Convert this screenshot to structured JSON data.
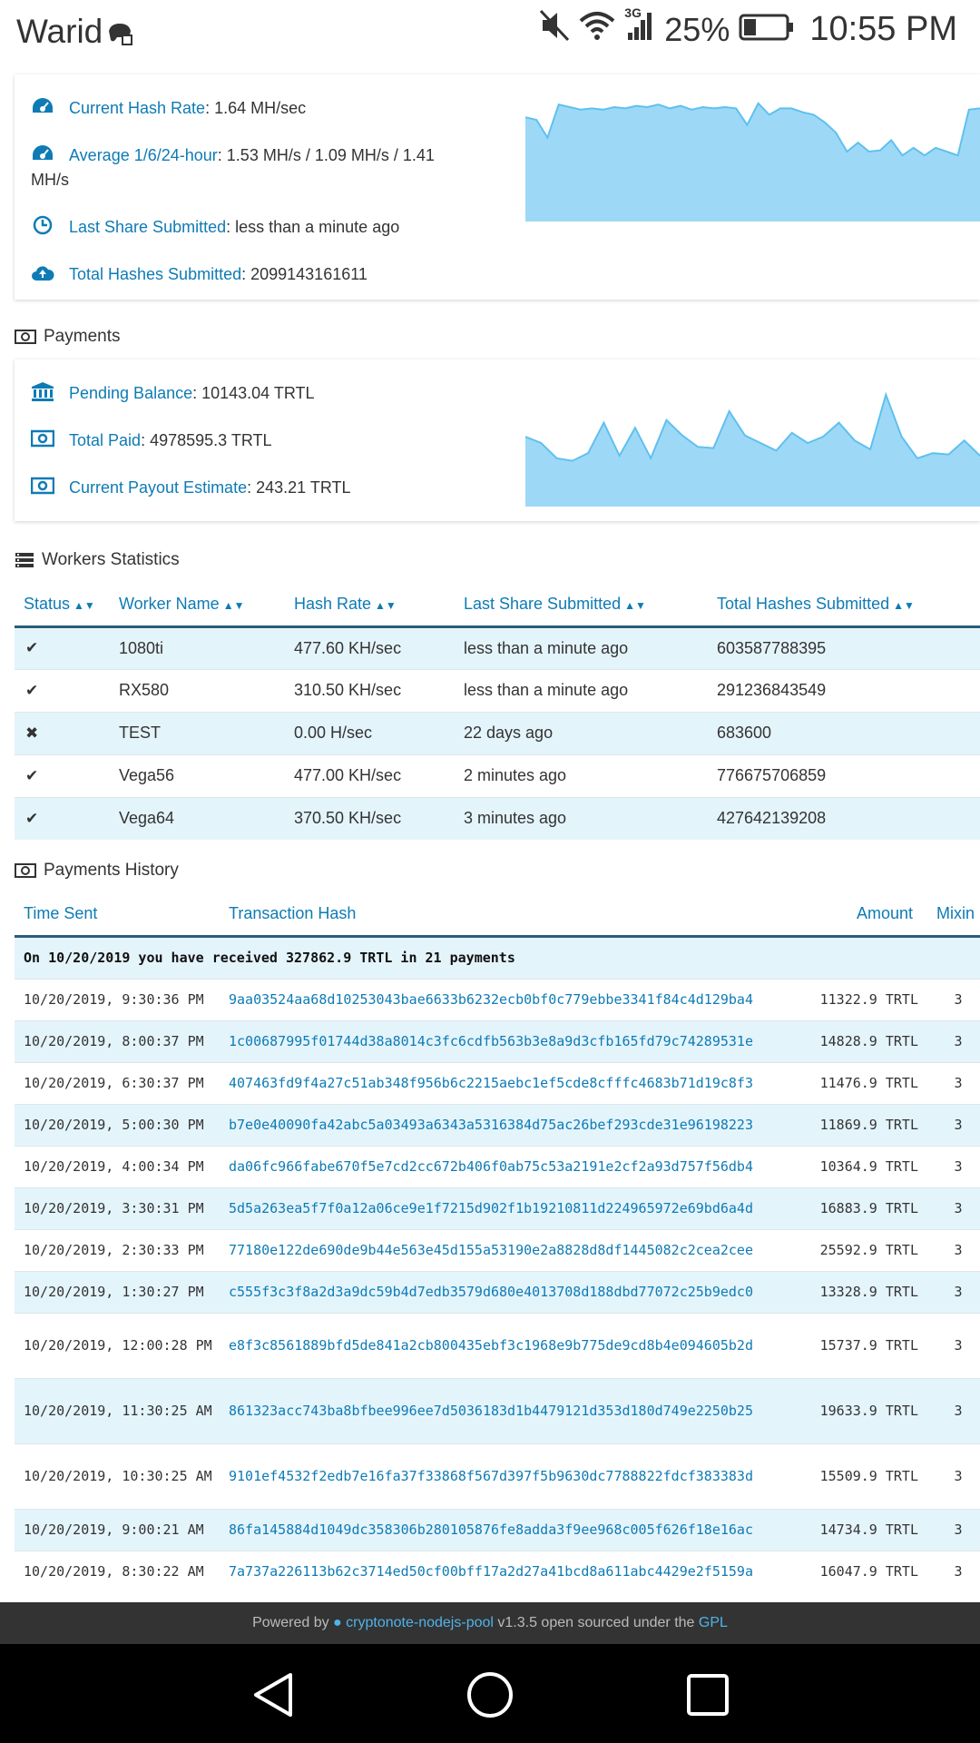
{
  "statusbar": {
    "carrier": "Warid",
    "battery": "25%",
    "time": "10:55 PM",
    "network": "3G"
  },
  "stats": {
    "hash_rate_label": "Current Hash Rate",
    "hash_rate_value": ": 1.64 MH/sec",
    "average_label": "Average 1/6/24-hour",
    "average_value": ": 1.53 MH/s / 1.09 MH/s / 1.41",
    "average_value_cont": "MH/s",
    "last_share_label": "Last Share Submitted",
    "last_share_value": ": less than a minute ago",
    "total_hashes_label": "Total Hashes Submitted",
    "total_hashes_value": ": 2099143161611"
  },
  "payments_section": {
    "title": "Payments",
    "pending_label": "Pending Balance",
    "pending_value": ": 10143.04 TRTL",
    "total_paid_label": "Total Paid",
    "total_paid_value": ": 4978595.3 TRTL",
    "estimate_label": "Current Payout Estimate",
    "estimate_value": ": 243.21 TRTL"
  },
  "chart_data": [
    {
      "type": "area",
      "y": [
        0.82,
        0.8,
        0.66,
        0.92,
        0.9,
        0.88,
        0.89,
        0.88,
        0.9,
        0.89,
        0.91,
        0.9,
        0.92,
        0.89,
        0.91,
        0.88,
        0.9,
        0.89,
        0.9,
        0.89,
        0.76,
        0.93,
        0.84,
        0.89,
        0.89,
        0.86,
        0.84,
        0.78,
        0.7,
        0.55,
        0.62,
        0.55,
        0.56,
        0.64,
        0.52,
        0.58,
        0.52,
        0.58,
        0.55,
        0.52,
        0.88,
        0.89
      ],
      "color": "#9dd9f6"
    },
    {
      "type": "area",
      "y": [
        0.55,
        0.5,
        0.38,
        0.36,
        0.42,
        0.66,
        0.4,
        0.62,
        0.38,
        0.68,
        0.56,
        0.47,
        0.46,
        0.75,
        0.56,
        0.5,
        0.44,
        0.58,
        0.5,
        0.55,
        0.66,
        0.52,
        0.45,
        0.88,
        0.55,
        0.38,
        0.42,
        0.41,
        0.52,
        0.4
      ],
      "color": "#9dd9f6"
    }
  ],
  "workers": {
    "title": "Workers Statistics",
    "headers": [
      "Status",
      "Worker Name",
      "Hash Rate",
      "Last Share Submitted",
      "Total Hashes Submitted"
    ],
    "rows": [
      {
        "status": "✔",
        "name": "1080ti",
        "rate": "477.60 KH/sec",
        "last": "less than a minute ago",
        "total": "603587788395"
      },
      {
        "status": "✔",
        "name": "RX580",
        "rate": "310.50 KH/sec",
        "last": "less than a minute ago",
        "total": "291236843549"
      },
      {
        "status": "✖",
        "name": "TEST",
        "rate": "0.00 H/sec",
        "last": "22 days ago",
        "total": "683600"
      },
      {
        "status": "✔",
        "name": "Vega56",
        "rate": "477.00 KH/sec",
        "last": "2 minutes ago",
        "total": "776675706859"
      },
      {
        "status": "✔",
        "name": "Vega64",
        "rate": "370.50 KH/sec",
        "last": "3 minutes ago",
        "total": "427642139208"
      }
    ]
  },
  "payments_history": {
    "title": "Payments History",
    "headers": [
      "Time Sent",
      "Transaction Hash",
      "Amount",
      "Mixin"
    ],
    "summary": "On 10/20/2019 you have received 327862.9 TRTL in 21 payments",
    "rows": [
      {
        "time": "10/20/2019, 9:30:36 PM",
        "hash": "9aa03524aa68d10253043bae6633b6232ecb0bf0c779ebbe3341f84c4d129ba4",
        "amount": "11322.9 TRTL",
        "mixin": "3"
      },
      {
        "time": "10/20/2019, 8:00:37 PM",
        "hash": "1c00687995f01744d38a8014c3fc6cdfb563b3e8a9d3cfb165fd79c74289531e",
        "amount": "14828.9 TRTL",
        "mixin": "3"
      },
      {
        "time": "10/20/2019, 6:30:37 PM",
        "hash": "407463fd9f4a27c51ab348f956b6c2215aebc1ef5cde8cfffc4683b71d19c8f3",
        "amount": "11476.9 TRTL",
        "mixin": "3"
      },
      {
        "time": "10/20/2019, 5:00:30 PM",
        "hash": "b7e0e40090fa42abc5a03493a6343a5316384d75ac26bef293cde31e96198223",
        "amount": "11869.9 TRTL",
        "mixin": "3"
      },
      {
        "time": "10/20/2019, 4:00:34 PM",
        "hash": "da06fc966fabe670f5e7cd2cc672b406f0ab75c53a2191e2cf2a93d757f56db4",
        "amount": "10364.9 TRTL",
        "mixin": "3"
      },
      {
        "time": "10/20/2019, 3:30:31 PM",
        "hash": "5d5a263ea5f7f0a12a06ce9e1f7215d902f1b19210811d224965972e69bd6a4d",
        "amount": "16883.9 TRTL",
        "mixin": "3"
      },
      {
        "time": "10/20/2019, 2:30:33 PM",
        "hash": "77180e122de690de9b44e563e45d155a53190e2a8828d8df1445082c2cea2cee",
        "amount": "25592.9 TRTL",
        "mixin": "3"
      },
      {
        "time": "10/20/2019, 1:30:27 PM",
        "hash": "c555f3c3f8a2d3a9dc59b4d7edb3579d680e4013708d188dbd77072c25b9edc0",
        "amount": "13328.9 TRTL",
        "mixin": "3"
      },
      {
        "time": "10/20/2019, 12:00:28 PM",
        "hash": "e8f3c8561889bfd5de841a2cb800435ebf3c1968e9b775de9cd8b4e094605b2d",
        "amount": "15737.9 TRTL",
        "mixin": "3"
      },
      {
        "time": "10/20/2019, 11:30:25 AM",
        "hash": "861323acc743ba8bfbee996ee7d5036183d1b4479121d353d180d749e2250b25",
        "amount": "19633.9 TRTL",
        "mixin": "3"
      },
      {
        "time": "10/20/2019, 10:30:25 AM",
        "hash": "9101ef4532f2edb7e16fa37f33868f567d397f5b9630dc7788822fdcf383383d",
        "amount": "15509.9 TRTL",
        "mixin": "3"
      },
      {
        "time": "10/20/2019, 9:00:21 AM",
        "hash": "86fa145884d1049dc358306b280105876fe8adda3f9ee968c005f626f18e16ac",
        "amount": "14734.9 TRTL",
        "mixin": "3"
      },
      {
        "time": "10/20/2019, 8:30:22 AM",
        "hash": "7a737a226113b62c3714ed50cf00bff17a2d27a41bcd8a611abc4429e2f5159a",
        "amount": "16047.9 TRTL",
        "mixin": "3"
      }
    ]
  },
  "footer": {
    "prefix": "Powered by ",
    "link": "cryptonote-nodejs-pool",
    "middle": " v1.3.5 open sourced under the ",
    "license": "GPL"
  },
  "colors": {
    "accent": "#0e7bb5",
    "chart_fill": "#9dd9f6",
    "row_alt": "#e4f4fb",
    "footer_bg": "#333333"
  }
}
